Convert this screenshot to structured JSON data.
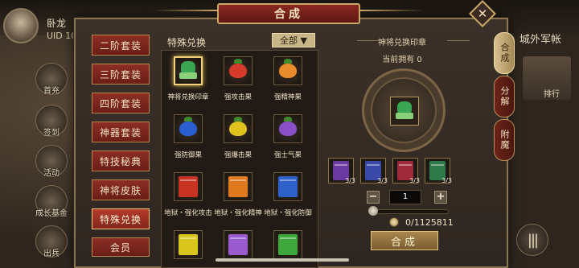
{
  "player": {
    "name": "卧龙",
    "uid": "UID 10"
  },
  "left_hud": [
    {
      "name": "first-charge",
      "label": "首充"
    },
    {
      "name": "sign-in",
      "label": "签到"
    },
    {
      "name": "events",
      "label": "活动"
    },
    {
      "name": "growth-fund",
      "label": "成长基金"
    },
    {
      "name": "deploy",
      "label": "出兵"
    }
  ],
  "right_hud": {
    "title": "城外军帐",
    "rank_label": "排行"
  },
  "panel": {
    "title": "合成",
    "close_glyph": "✕"
  },
  "categories": [
    {
      "label": "二阶套装",
      "active": false
    },
    {
      "label": "三阶套装",
      "active": false
    },
    {
      "label": "四阶套装",
      "active": false
    },
    {
      "label": "神器套装",
      "active": false
    },
    {
      "label": "特技秘典",
      "active": false
    },
    {
      "label": "神将皮肤",
      "active": false
    },
    {
      "label": "特殊兑换",
      "active": true
    },
    {
      "label": "会员",
      "active": false
    }
  ],
  "grid": {
    "header": "特殊兑换",
    "filter_label": "全部 ▼",
    "items": [
      {
        "label": "神将兑换印章",
        "icon": "seal-icon",
        "color": "#3aa552",
        "selected": true
      },
      {
        "label": "强攻击果",
        "icon": "fruit-icon",
        "color": "#d63a2a",
        "selected": false
      },
      {
        "label": "强精神果",
        "icon": "fruit-icon",
        "color": "#e98b2a",
        "selected": false
      },
      {
        "label": "强防御果",
        "icon": "fruit-icon",
        "color": "#2b5fd1",
        "selected": false
      },
      {
        "label": "强爆击果",
        "icon": "fruit-icon",
        "color": "#e0c21f",
        "selected": false
      },
      {
        "label": "强士气果",
        "icon": "fruit-icon",
        "color": "#8a4fc9",
        "selected": false
      },
      {
        "label": "地狱・强化攻击",
        "icon": "book-icon",
        "color": "#c73424",
        "selected": false
      },
      {
        "label": "地狱・强化精神",
        "icon": "book-icon",
        "color": "#e07a1f",
        "selected": false
      },
      {
        "label": "地狱・强化防御",
        "icon": "book-icon",
        "color": "#2f62c8",
        "selected": false
      },
      {
        "label": "",
        "icon": "book-icon",
        "color": "#d9c61c",
        "selected": false
      },
      {
        "label": "",
        "icon": "book-icon",
        "color": "#9a5bd0",
        "selected": false
      },
      {
        "label": "",
        "icon": "book-icon",
        "color": "#3fa83c",
        "selected": false
      }
    ]
  },
  "detail": {
    "title": "神将兑换印章",
    "owned": "当前拥有 0",
    "materials": [
      {
        "icon": "book-icon",
        "color": "#6b3aa0",
        "count": "3/3"
      },
      {
        "icon": "book-icon",
        "color": "#3a49a8",
        "count": "3/3"
      },
      {
        "icon": "book-icon",
        "color": "#a02a3a",
        "count": "3/3"
      },
      {
        "icon": "book-icon",
        "color": "#2e7a4a",
        "count": "3/3"
      }
    ],
    "quantity": "1",
    "minus": "−",
    "plus": "+",
    "slider_fraction": 0,
    "cost": "0/1125811",
    "combine_label": "合成"
  },
  "side_tabs": [
    {
      "label": "合成",
      "active": true
    },
    {
      "label": "分解",
      "active": false
    },
    {
      "label": "附魔",
      "active": false
    }
  ],
  "menu_glyph": "|||"
}
